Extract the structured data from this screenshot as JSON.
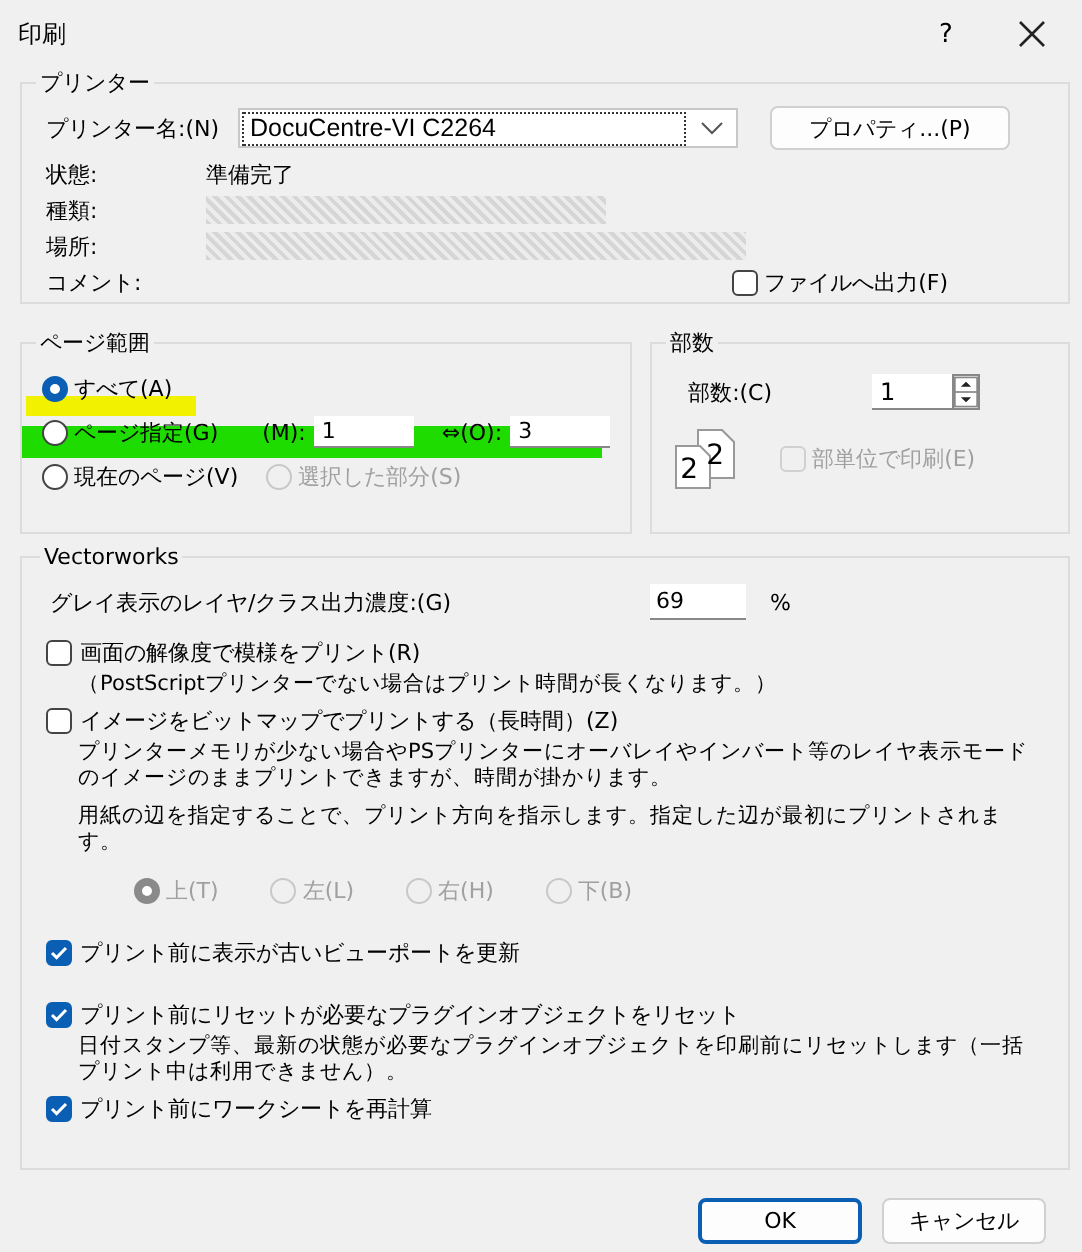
{
  "window": {
    "title": "印刷",
    "help": "?"
  },
  "printer": {
    "title": "プリンター",
    "name_label": "プリンター名:(N)",
    "name_value": "DocuCentre-VI C2264",
    "properties_button": "プロパティ...(P)",
    "fields": [
      {
        "label": "状態:",
        "value": "準備完了",
        "redacted": false
      },
      {
        "label": "種類:",
        "redacted": true
      },
      {
        "label": "場所:",
        "redacted": true
      },
      {
        "label": "コメント:",
        "redacted": false
      }
    ],
    "print_to_file": {
      "label": "ファイルへ出力(F)",
      "checked": false
    }
  },
  "page_range": {
    "title": "ページ範囲",
    "rows": [
      {
        "options": [
          {
            "kind": "plain",
            "label": "すべて(A)",
            "selected": true,
            "disabled": false,
            "color": "#f2f200"
          }
        ]
      },
      {
        "options": [
          {
            "kind": "range",
            "label": "ページ指定(G)",
            "selected": false,
            "disabled": false,
            "color": "#1edc00",
            "from_label": "(M):",
            "from_value": "1",
            "to_label": "⇔(O):",
            "to_value": "3"
          }
        ]
      },
      {
        "options": [
          {
            "kind": "plain",
            "label": "現在のページ(V)",
            "selected": false,
            "disabled": false
          },
          {
            "kind": "plain",
            "label": "選択した部分(S)",
            "selected": false,
            "disabled": true
          }
        ]
      }
    ]
  },
  "copies": {
    "title": "部数",
    "label": "部数:(C)",
    "value": "1",
    "sample_pages": [
      "2",
      "2"
    ],
    "collate": {
      "label": "部単位で印刷(E)",
      "checked": false,
      "disabled": true
    }
  },
  "vectorworks": {
    "title": "Vectorworks",
    "items": [
      {
        "kind": "number",
        "label": "グレイ表示のレイヤ/クラス出力濃度:(G)",
        "value": "69",
        "unit": "%"
      },
      {
        "kind": "checkbox",
        "label": "画面の解像度で模様をプリント(R)",
        "checked": false,
        "notes": [
          "（PostScriptプリンターでない場合はプリント時間が長くなります。）"
        ]
      },
      {
        "kind": "checkbox",
        "label": "イメージをビットマップでプリントする（長時間）(Z)",
        "checked": false,
        "notes": [
          "プリンターメモリが少ない場合やPSプリンターにオーバレイやインバート等のレイヤ表示モードのイメージのままプリントできますが、時間が掛かります。",
          "用紙の辺を指定することで、プリント方向を指示します。指定した辺が最初にプリントされます。"
        ]
      },
      {
        "kind": "radios",
        "options": [
          {
            "label": "上(T)",
            "selected": true,
            "disabled": true
          },
          {
            "label": "左(L)",
            "selected": false,
            "disabled": true
          },
          {
            "label": "右(H)",
            "selected": false,
            "disabled": true
          },
          {
            "label": "下(B)",
            "selected": false,
            "disabled": true
          }
        ]
      },
      {
        "kind": "checkbox",
        "label": "プリント前に表示が古いビューポートを更新",
        "checked": true
      },
      {
        "kind": "checkbox",
        "label": "プリント前にリセットが必要なプラグインオブジェクトをリセット",
        "checked": true,
        "notes": [
          "日付スタンプ等、最新の状態が必要なプラグインオブジェクトを印刷前にリセットします（一括プリント中は利用できません）。"
        ]
      },
      {
        "kind": "checkbox",
        "label": "プリント前にワークシートを再計算",
        "checked": true
      }
    ]
  },
  "buttons": [
    {
      "label": "OK",
      "default": true
    },
    {
      "label": "キャンセル",
      "default": false
    }
  ]
}
